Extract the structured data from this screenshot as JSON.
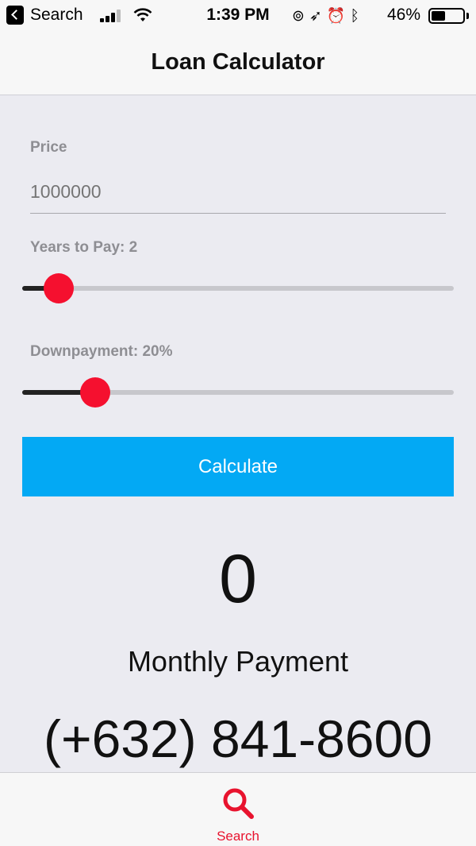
{
  "status_bar": {
    "back_label": "Search",
    "time": "1:39 PM",
    "battery_percent": "46%",
    "battery_level": 0.46,
    "icons": [
      "signal-icon",
      "wifi-icon",
      "orientation-lock-icon",
      "location-icon",
      "alarm-icon",
      "bluetooth-icon",
      "battery-icon"
    ]
  },
  "nav": {
    "title": "Loan Calculator"
  },
  "form": {
    "price_label": "Price",
    "price_placeholder": "1000000",
    "years_label": "Years to Pay: 2",
    "years_slider_fraction": 0.085,
    "downpayment_label": "Downpayment: 20%",
    "downpayment_slider_fraction": 0.17,
    "calculate_label": "Calculate"
  },
  "result": {
    "value": "0",
    "label": "Monthly Payment",
    "phone": "(+632) 841-8600"
  },
  "tabbar": {
    "items": [
      {
        "label": "Search",
        "icon": "search-icon"
      }
    ]
  },
  "colors": {
    "accent_red": "#f5102f",
    "button_blue": "#03a9f4",
    "background": "#ebebf1"
  }
}
